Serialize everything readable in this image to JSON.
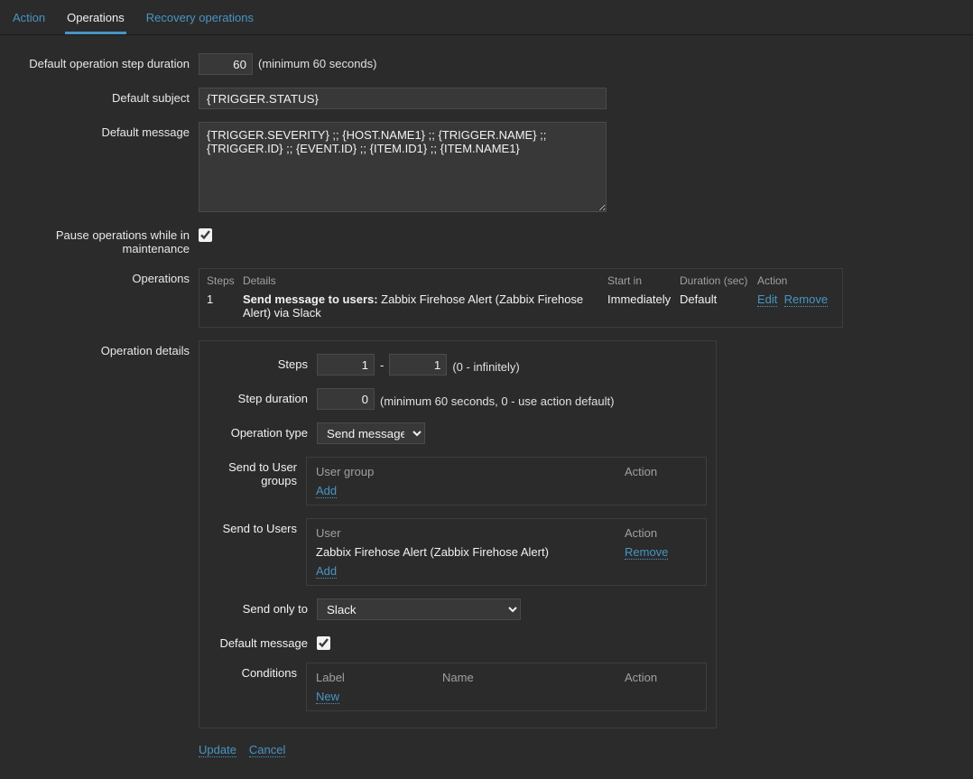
{
  "tabs": {
    "action": "Action",
    "operations": "Operations",
    "recovery": "Recovery operations"
  },
  "form": {
    "default_step_duration_label": "Default operation step duration",
    "default_step_duration_value": "60",
    "default_step_duration_hint": "(minimum 60 seconds)",
    "default_subject_label": "Default subject",
    "default_subject_value": "{TRIGGER.STATUS}",
    "default_message_label": "Default message",
    "default_message_value": "{TRIGGER.SEVERITY} ;; {HOST.NAME1} ;; {TRIGGER.NAME} ;; {TRIGGER.ID} ;; {EVENT.ID} ;; {ITEM.ID1} ;; {ITEM.NAME1}",
    "pause_label": "Pause operations while in maintenance",
    "operations_label": "Operations"
  },
  "ops_table": {
    "h_steps": "Steps",
    "h_details": "Details",
    "h_start": "Start in",
    "h_dur": "Duration (sec)",
    "h_action": "Action",
    "row_step": "1",
    "row_details_bold": "Send message to users:",
    "row_details_rest": " Zabbix Firehose Alert (Zabbix Firehose Alert) via Slack",
    "row_start": "Immediately",
    "row_dur": "Default",
    "row_a_edit": "Edit",
    "row_a_remove": "Remove"
  },
  "opdetails": {
    "section_label": "Operation details",
    "steps_label": "Steps",
    "steps_from": "1",
    "steps_sep": "-",
    "steps_to": "1",
    "steps_hint": "(0 - infinitely)",
    "stepdur_label": "Step duration",
    "stepdur_value": "0",
    "stepdur_hint": "(minimum 60 seconds, 0 - use action default)",
    "optype_label": "Operation type",
    "optype_value": "Send message",
    "send_groups_label": "Send to User groups",
    "send_groups_h_left": "User group",
    "send_groups_h_right": "Action",
    "send_groups_add": "Add",
    "send_users_label": "Send to Users",
    "send_users_h_left": "User",
    "send_users_h_right": "Action",
    "send_users_val": "Zabbix Firehose Alert (Zabbix Firehose Alert)",
    "send_users_remove": "Remove",
    "send_users_add": "Add",
    "send_only_label": "Send only to",
    "send_only_value": "Slack",
    "defmsg_label": "Default message",
    "cond_label": "Conditions",
    "cond_h_label": "Label",
    "cond_h_name": "Name",
    "cond_h_action": "Action",
    "cond_new": "New",
    "footer_update": "Update",
    "footer_cancel": "Cancel"
  }
}
